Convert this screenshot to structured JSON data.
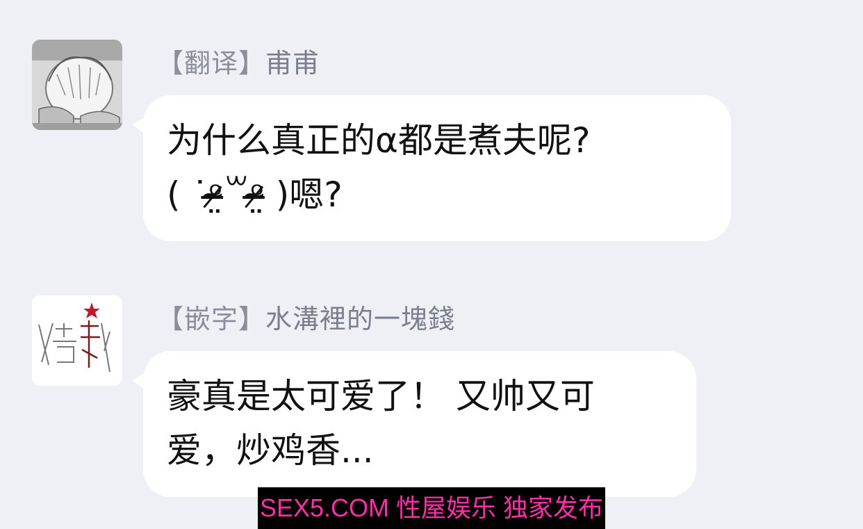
{
  "messages": [
    {
      "sender_tag": "【翻译】",
      "sender_name": "甫甫",
      "avatar_icon": "manga-boy-avatar-icon",
      "lines": [
        "为什么真正的α都是煮夫呢?",
        "( ˙ᵒ̴̶̷̤꒳ᵒ̴̶̷̤ )嗯?"
      ]
    },
    {
      "sender_tag": "【嵌字】",
      "sender_name": "水溝裡的一塊錢",
      "avatar_icon": "handwritten-calligraphy-avatar-icon",
      "lines": [
        "豪真是太可爱了！ 又帅又可",
        "爱，炒鸡香..."
      ]
    }
  ],
  "watermark": {
    "text": "SEX5.COM 性屋娱乐 独家发布"
  },
  "colors": {
    "background": "#eef0f5",
    "bubble": "#ffffff",
    "sender_text": "#7a7f8c",
    "watermark_bg": "#000000",
    "watermark_text": "#ff2fa6"
  }
}
